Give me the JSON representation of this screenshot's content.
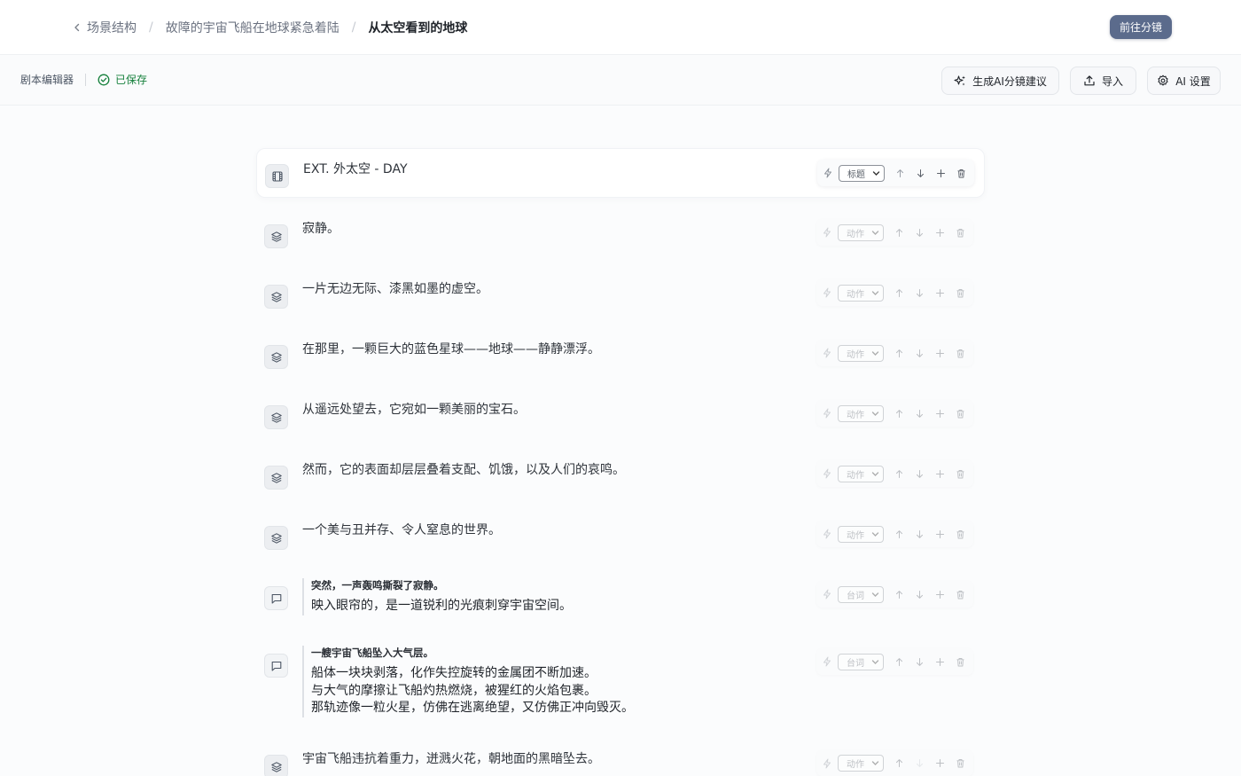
{
  "breadcrumb": {
    "items": [
      "场景结构",
      "故障的宇宙飞船在地球紧急着陆",
      "从太空看到的地球"
    ]
  },
  "header": {
    "primary_button": "前往分镜"
  },
  "toolbar": {
    "title": "剧本编辑器",
    "saved": "已保存",
    "ai_suggest": "生成AI分镜建议",
    "import": "导入",
    "ai_settings": "AI 设置"
  },
  "rows": [
    {
      "kind": "heading",
      "text": "EXT. 外太空 - DAY",
      "type": "标题"
    },
    {
      "kind": "action",
      "text": "寂静。",
      "type": "动作"
    },
    {
      "kind": "action",
      "text": "一片无边无际、漆黑如墨的虚空。",
      "type": "动作"
    },
    {
      "kind": "action",
      "text": "在那里，一颗巨大的蓝色星球——地球——静静漂浮。",
      "type": "动作"
    },
    {
      "kind": "action",
      "text": "从遥远处望去，它宛如一颗美丽的宝石。",
      "type": "动作"
    },
    {
      "kind": "action",
      "text": "然而，它的表面却层层叠着支配、饥饿，以及人们的哀鸣。",
      "type": "动作"
    },
    {
      "kind": "action",
      "text": "一个美与丑并存、令人窒息的世界。",
      "type": "动作"
    },
    {
      "kind": "dialogue",
      "head": "突然，一声轰鸣撕裂了寂静。",
      "lines": [
        "映入眼帘的，是一道锐利的光痕刺穿宇宙空间。"
      ],
      "type": "台词"
    },
    {
      "kind": "dialogue",
      "head": "一艘宇宙飞船坠入大气层。",
      "lines": [
        "船体一块块剥落，化作失控旋转的金属团不断加速。",
        "与大气的摩擦让飞船灼热燃烧，被猩红的火焰包裹。",
        "那轨迹像一粒火星，仿佛在逃离绝望，又仿佛正冲向毁灭。"
      ],
      "type": "台词"
    },
    {
      "kind": "action",
      "text": "宇宙飞船违抗着重力，迸溅火花，朝地面的黑暗坠去。",
      "type": "动作"
    }
  ]
}
